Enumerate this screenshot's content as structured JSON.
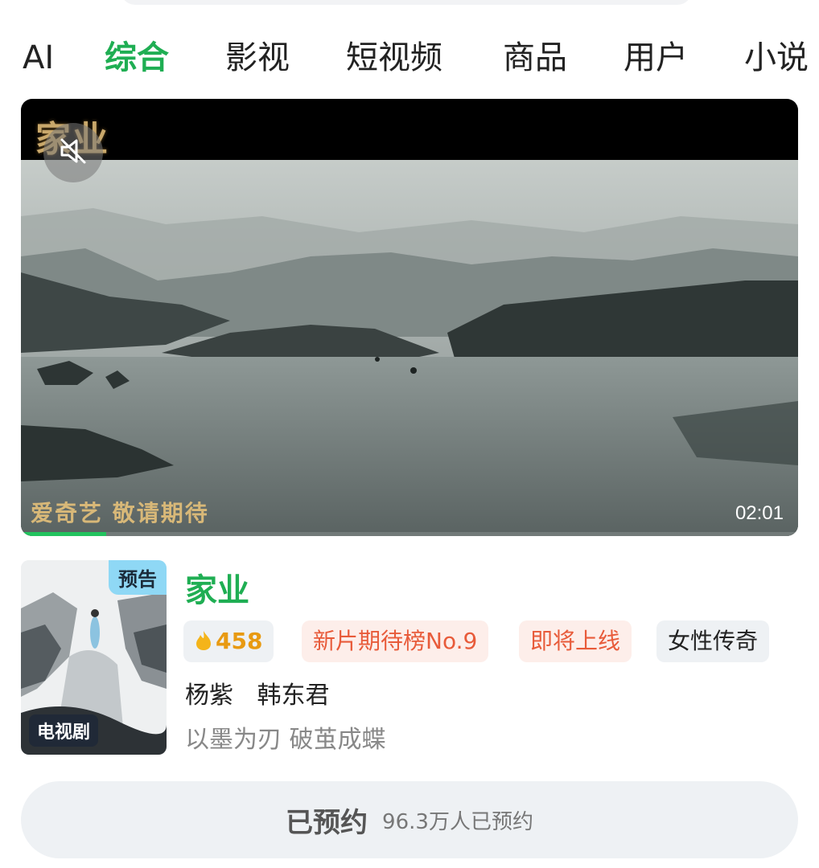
{
  "tabs": [
    {
      "label": "AI",
      "active": false
    },
    {
      "label": "综合",
      "active": true
    },
    {
      "label": "影视",
      "active": false
    },
    {
      "label": "短视频",
      "active": false
    },
    {
      "label": "商品",
      "active": false
    },
    {
      "label": "用户",
      "active": false
    },
    {
      "label": "小说",
      "active": false
    }
  ],
  "video": {
    "logo_text": "家业",
    "caption": "爱奇艺 敬请期待",
    "duration": "02:01",
    "progress_fraction": 0.11,
    "mute_icon": "volume-off-icon"
  },
  "item": {
    "poster_tag": "预告",
    "poster_type": "电视剧",
    "title": "家业",
    "hot_score": "458",
    "chips": {
      "rank": "新片期待榜No.9",
      "status": "即将上线",
      "genre": "女性传奇"
    },
    "cast": [
      "杨紫",
      "韩东君"
    ],
    "tagline": "以墨为刃 破茧成蝶"
  },
  "reserve": {
    "label": "已预约",
    "count": "96.3万人已预约"
  },
  "colors": {
    "accent": "#1fae53",
    "chip_warning_text": "#e85b3a",
    "hot_text": "#e89a12",
    "progress": "#22c35e"
  }
}
